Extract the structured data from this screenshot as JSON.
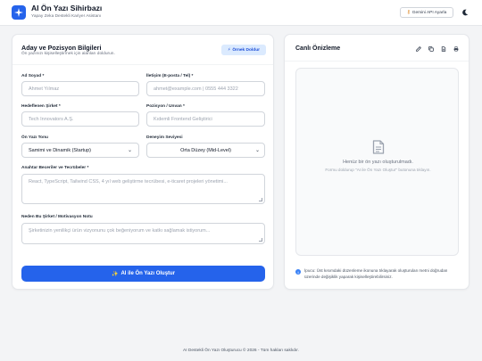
{
  "header": {
    "title": "AI Ön Yazı Sihirbazı",
    "subtitle": "Yapay Zeka Destekli Kariyer Asistanı",
    "api_button": "Gemini API Ayarla"
  },
  "form": {
    "title": "Aday ve Pozisyon Bilgileri",
    "subtitle": "Ön yazınızı kişiselleştirmek için alanları doldurun.",
    "example_button": "Örnek Doldur",
    "name_label": "Ad Soyad *",
    "name_placeholder": "Ahmet Yılmaz",
    "contact_label": "İletişim (E-posta / Tel) *",
    "contact_placeholder": "ahmet@example.com | 0555 444 3322",
    "company_label": "Hedeflenen Şirket *",
    "company_placeholder": "Tech Innovators A.Ş.",
    "position_label": "Pozisyon / Unvan *",
    "position_placeholder": "Kıdemli Frontend Geliştirici",
    "tone_label": "Ön Yazı Tonu",
    "tone_value": "Samimi ve Dinamik (Startup)",
    "experience_label": "Deneyim Seviyesi",
    "experience_value": "Orta Düzey (Mid-Level)",
    "skills_label": "Anahtar Beceriler ve Tecrübeler *",
    "skills_placeholder": "React, TypeScript, Tailwind CSS, 4 yıl web geliştirme tecrübesi, e-ticaret projeleri yönetimi...",
    "motivation_label": "Neden Bu Şirket / Motivasyon Notu",
    "motivation_placeholder": "Şirketinizin yenilikçi ürün vizyonunu çok beğeniyorum ve katkı sağlamak istiyorum...",
    "generate_button": "AI ile Ön Yazı Oluştur"
  },
  "preview": {
    "title": "Canlı Önizleme",
    "empty_title": "Henüz bir ön yazı oluşturulmadı.",
    "empty_subtitle": "Formu doldurup \"AI ile Ön Yazı Oluştur\" butonuna tıklayın.",
    "tip": "İpucu: Üst kısımdaki düzenleme ikonuna tıklayarak oluşturulan metni doğrudan üzerinde değişiklik yaparak kişiselleştirebilirsiniz."
  },
  "footer": {
    "text": "AI Destekli Ön Yazı Oluşturucu © 2026 - Tüm hakları saklıdır."
  },
  "colors": {
    "accent": "#2563eb",
    "accent_light": "#dbeafe",
    "background": "#f3f4f6"
  },
  "icons": [
    "sparkle-icon",
    "key-icon",
    "moon-icon",
    "wand-icon",
    "edit-icon",
    "copy-icon",
    "download-icon",
    "print-icon",
    "document-icon",
    "info-icon"
  ]
}
